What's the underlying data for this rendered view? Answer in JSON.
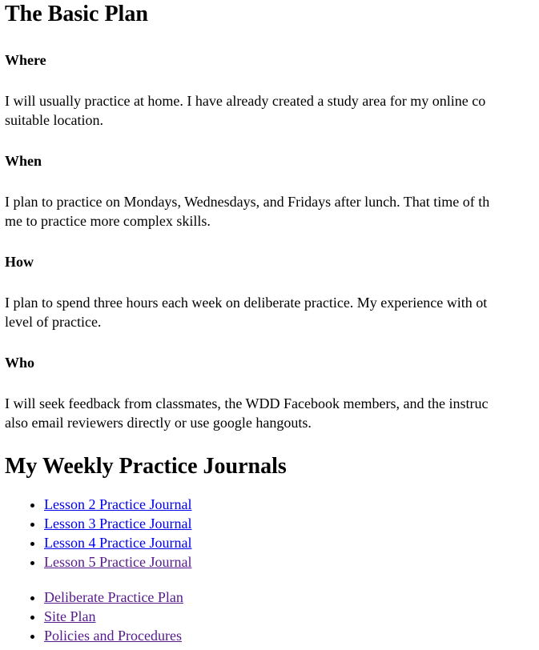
{
  "title": "The Basic Plan",
  "sections": [
    {
      "heading": "Where",
      "lines": [
        "I will usually practice at home. I have already created a study area for my online co",
        "suitable location."
      ]
    },
    {
      "heading": "When",
      "lines": [
        "I plan to practice on Mondays, Wednesdays, and Fridays after lunch. That time of th",
        "me to practice more complex skills."
      ]
    },
    {
      "heading": "How",
      "lines": [
        "I plan to spend three hours each week on deliberate practice. My experience with ot",
        "level of practice."
      ]
    },
    {
      "heading": "Who",
      "lines": [
        "I will seek feedback from classmates, the WDD Facebook members, and the instruc",
        "also email reviewers directly or use google hangouts."
      ]
    }
  ],
  "journals_heading": "My Weekly Practice Journals",
  "journals": [
    {
      "label": "Lesson 2 Practice Journal",
      "visited": false
    },
    {
      "label": "Lesson 3 Practice Journal",
      "visited": false
    },
    {
      "label": "Lesson 4 Practice Journal",
      "visited": false
    },
    {
      "label": "Lesson 5 Practice Journal",
      "visited": true
    }
  ],
  "links": [
    {
      "label": "Deliberate Practice Plan",
      "visited": true
    },
    {
      "label": "Site Plan",
      "visited": true
    },
    {
      "label": "Policies and Procedures",
      "visited": true
    }
  ],
  "colors": {
    "link": "#0000EE",
    "visited_link": "#551A8B",
    "text": "#000000",
    "background": "#FFFFFF"
  }
}
